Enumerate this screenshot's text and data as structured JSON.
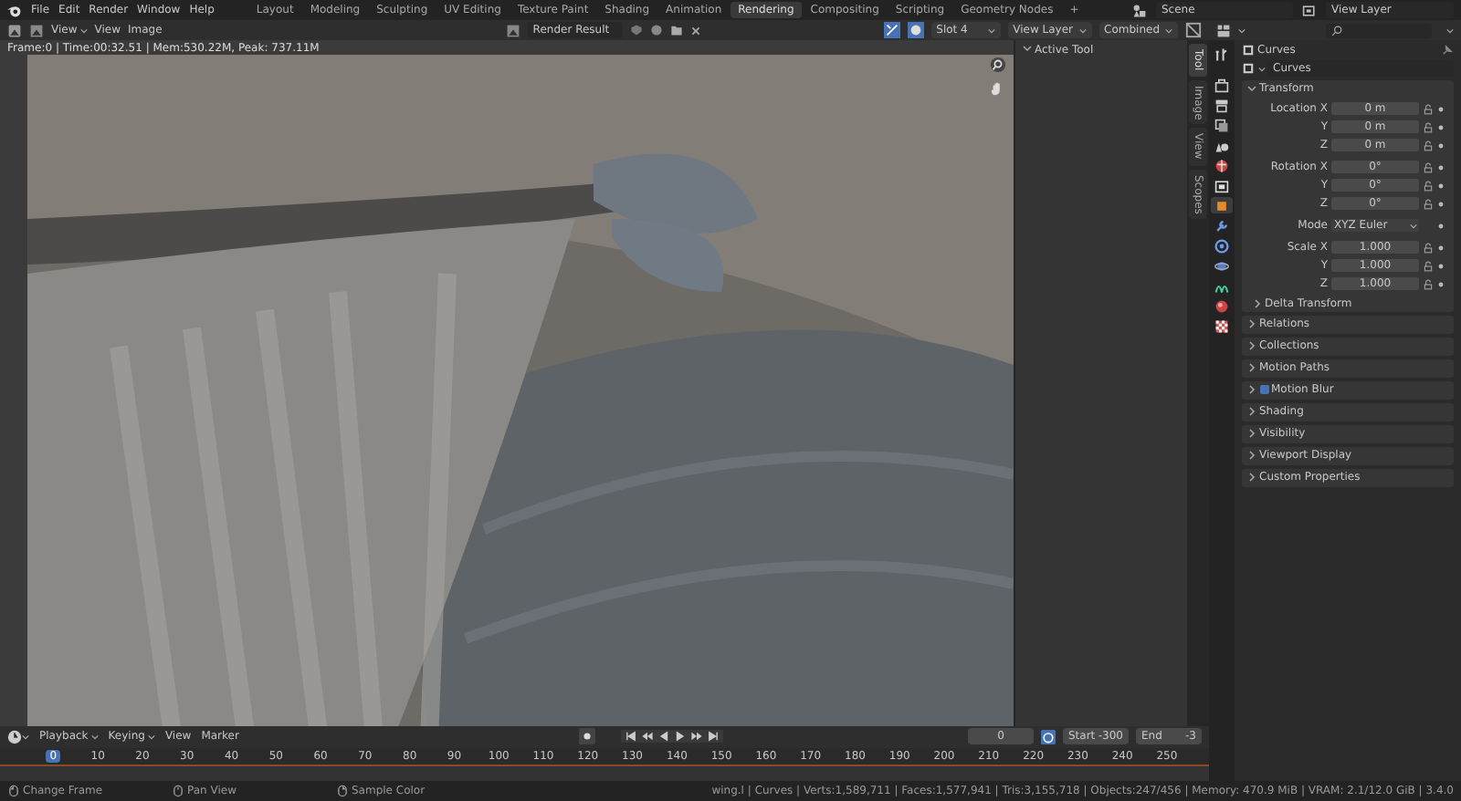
{
  "top_bar": {
    "menus": [
      "File",
      "Edit",
      "Render",
      "Window",
      "Help"
    ],
    "workspaces": [
      {
        "label": "Layout",
        "selected": false
      },
      {
        "label": "Modeling",
        "selected": false
      },
      {
        "label": "Sculpting",
        "selected": false
      },
      {
        "label": "UV Editing",
        "selected": false
      },
      {
        "label": "Texture Paint",
        "selected": false
      },
      {
        "label": "Shading",
        "selected": false
      },
      {
        "label": "Animation",
        "selected": false
      },
      {
        "label": "Rendering",
        "selected": true
      },
      {
        "label": "Compositing",
        "selected": false
      },
      {
        "label": "Scripting",
        "selected": false
      },
      {
        "label": "Geometry Nodes",
        "selected": false
      }
    ],
    "add_workspace": "+",
    "scene": "Scene",
    "view_layer": "View Layer"
  },
  "image_editor": {
    "mode": "View",
    "menus": [
      "View",
      "Image"
    ],
    "image": "Render Result",
    "slot": "Slot 4",
    "layer": "View Layer",
    "pass": "Combined",
    "render_info": "Frame:0 | Time:00:32.51 | Mem:530.22M, Peak: 737.11M",
    "sidebar": {
      "panel": "Active Tool",
      "expanded": true
    },
    "sidebar_tabs": [
      {
        "label": "Tool",
        "selected": true
      },
      {
        "label": "Image",
        "selected": false
      },
      {
        "label": "View",
        "selected": false
      },
      {
        "label": "Scopes",
        "selected": false
      }
    ]
  },
  "properties": {
    "tabs": [
      {
        "kind": "tool",
        "selected": false
      },
      {
        "kind": "render",
        "selected": false
      },
      {
        "kind": "output",
        "selected": false
      },
      {
        "kind": "view_layer",
        "selected": false
      },
      {
        "kind": "scene",
        "selected": false
      },
      {
        "kind": "world",
        "selected": false
      },
      {
        "kind": "collection",
        "selected": false
      },
      {
        "kind": "object",
        "selected": true
      },
      {
        "kind": "modifiers",
        "selected": false
      },
      {
        "kind": "particles",
        "selected": false
      },
      {
        "kind": "physics",
        "selected": false
      },
      {
        "kind": "data",
        "selected": false
      },
      {
        "kind": "material",
        "selected": false
      },
      {
        "kind": "texture",
        "selected": false
      }
    ],
    "object": "Curves",
    "datablock": "Curves",
    "transform": {
      "title": "Transform",
      "expanded": true,
      "rows": [
        {
          "kind": "number",
          "label": "Location X",
          "value": "0 m"
        },
        {
          "kind": "number",
          "label": "Y",
          "value": "0 m"
        },
        {
          "kind": "number",
          "label": "Z",
          "value": "0 m"
        },
        {
          "kind": "number",
          "label": "Rotation X",
          "value": "0°"
        },
        {
          "kind": "number",
          "label": "Y",
          "value": "0°"
        },
        {
          "kind": "number",
          "label": "Z",
          "value": "0°"
        },
        {
          "kind": "dropdown",
          "label": "Mode",
          "value": "XYZ Euler"
        },
        {
          "kind": "number",
          "label": "Scale X",
          "value": "1.000"
        },
        {
          "kind": "number",
          "label": "Y",
          "value": "1.000"
        },
        {
          "kind": "number",
          "label": "Z",
          "value": "1.000"
        }
      ],
      "subpanels": [
        {
          "title": "Delta Transform",
          "expanded": false
        }
      ]
    },
    "panels": [
      {
        "kind": "panel",
        "title": "Relations",
        "expanded": false
      },
      {
        "kind": "panel",
        "title": "Collections",
        "expanded": false
      },
      {
        "kind": "panel",
        "title": "Motion Paths",
        "expanded": false
      },
      {
        "kind": "checkbox",
        "title": "Motion Blur",
        "expanded": false,
        "checked": true
      },
      {
        "kind": "panel",
        "title": "Shading",
        "expanded": false
      },
      {
        "kind": "panel",
        "title": "Visibility",
        "expanded": false
      },
      {
        "kind": "panel",
        "title": "Viewport Display",
        "expanded": false
      },
      {
        "kind": "panel",
        "title": "Custom Properties",
        "expanded": false
      }
    ]
  },
  "timeline": {
    "menus": [
      {
        "label": "Playback",
        "dropdown": true
      },
      {
        "label": "Keying",
        "dropdown": true
      },
      {
        "label": "View",
        "dropdown": false
      },
      {
        "label": "Marker",
        "dropdown": false
      }
    ],
    "current_frame": "0",
    "start_label": "Start",
    "start": "-300",
    "end_label": "End",
    "end": "-3",
    "playhead": "0",
    "ticks": [
      "10",
      "20",
      "30",
      "40",
      "50",
      "60",
      "70",
      "80",
      "90",
      "100",
      "110",
      "120",
      "130",
      "140",
      "150",
      "160",
      "170",
      "180",
      "190",
      "200",
      "210",
      "220",
      "230",
      "240",
      "250"
    ]
  },
  "status_bar": {
    "hints": [
      {
        "kind": "left",
        "label": "Change Frame"
      },
      {
        "kind": "middle",
        "label": "Pan View"
      },
      {
        "kind": "right",
        "label": "Sample Color"
      }
    ],
    "stats": "wing.l | Curves | Verts:1,589,711 | Faces:1,577,941 | Tris:3,155,718 | Objects:247/456 | Memory: 470.9 MiB | VRAM: 2.1/12.0 GiB | 3.4.0"
  }
}
